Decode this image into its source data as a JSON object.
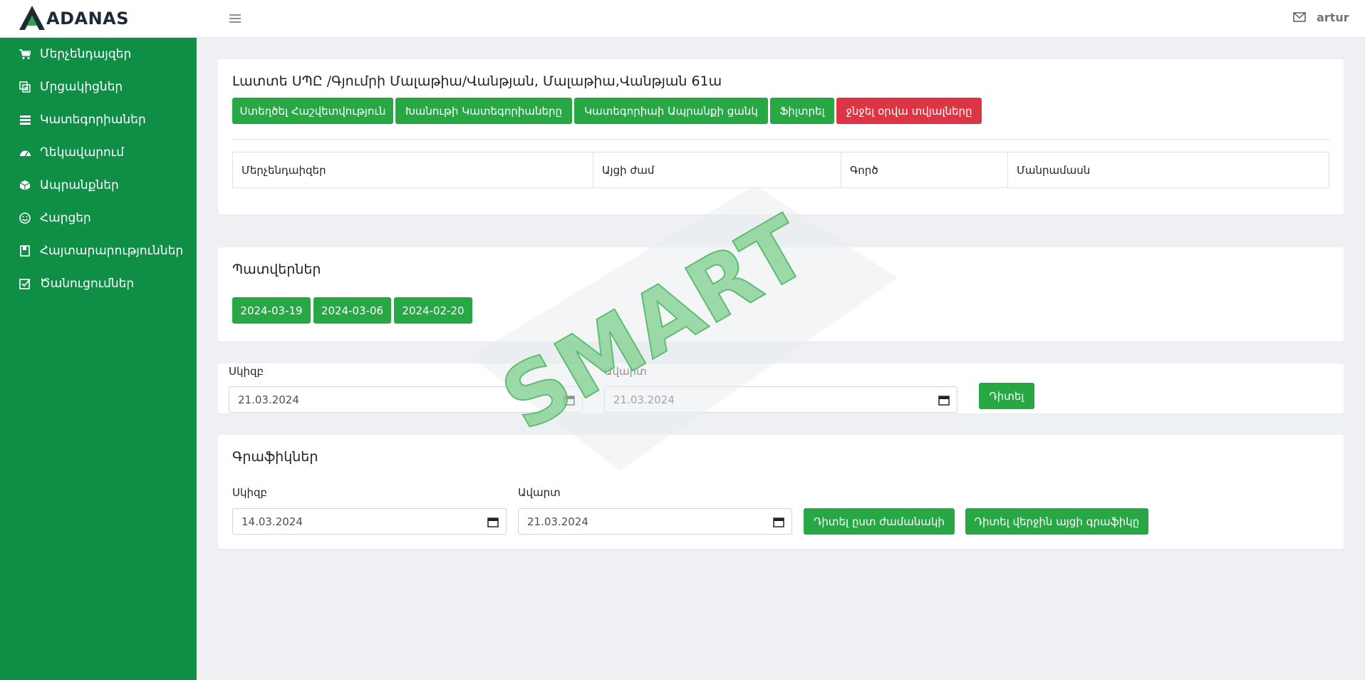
{
  "brand": {
    "name": "ADANAS"
  },
  "header": {
    "menu_icon": "hamburger-icon",
    "mail_icon": "mail-icon",
    "user": "artur"
  },
  "sidebar": {
    "items": [
      {
        "label": "Մերչենդայզեր",
        "icon": "cart-icon"
      },
      {
        "label": "Մրցակիցներ",
        "icon": "copy-icon"
      },
      {
        "label": "Կատեգորիաներ",
        "icon": "list-icon"
      },
      {
        "label": "Ղեկավարում",
        "icon": "dashboard-icon"
      },
      {
        "label": "Ապրանքներ",
        "icon": "box-icon"
      },
      {
        "label": "Հարցեր",
        "icon": "smile-icon"
      },
      {
        "label": "Հայտարարություններ",
        "icon": "book-icon"
      },
      {
        "label": "Ծանուցումներ",
        "icon": "check-square-icon"
      }
    ],
    "color": "#0f8e45"
  },
  "store": {
    "title": "Լատտե ՍՊԸ /Գյումրի Մալաթիա/Վանթյան, Մալաթիա,Վանթյան 61ա",
    "buttons": [
      {
        "label": "Ստեղծել Հաշվետվություն",
        "style": "green"
      },
      {
        "label": "Խանութի Կատեգորիաները",
        "style": "green"
      },
      {
        "label": "Կատեգորիաի Ապրանքի ցանկ",
        "style": "green"
      },
      {
        "label": "Ֆիլտրել",
        "style": "green"
      },
      {
        "label": "ջնջել օրվա տվյալները",
        "style": "red"
      }
    ],
    "table_headers": [
      "Մերչենդաիզեր",
      "Այցի ժամ",
      "Գործ",
      "Մանրամասն"
    ]
  },
  "orders": {
    "title": "Պատվերներ",
    "dates": [
      "2024-03-19",
      "2024-03-06",
      "2024-02-20"
    ]
  },
  "filter": {
    "start_label": "Սկիզբ",
    "start_value": "21.03.2024",
    "end_label": "Ավարտ",
    "end_value": "21.03.2024",
    "view_button": "Դիտել"
  },
  "graphs": {
    "title": "Գրաֆիկներ",
    "start_label": "Սկիզբ",
    "start_value": "14.03.2024",
    "end_label": "Ավարտ",
    "end_value": "21.03.2024",
    "by_time_button": "Դիտել ըստ ժամանակի",
    "last_visit_button": "Դիտել վերջին այցի գրաֆիկը"
  },
  "watermark": {
    "text": "SMART"
  },
  "colors": {
    "green": "#28a745",
    "red": "#dc3545",
    "sidebar": "#0f8e45"
  }
}
